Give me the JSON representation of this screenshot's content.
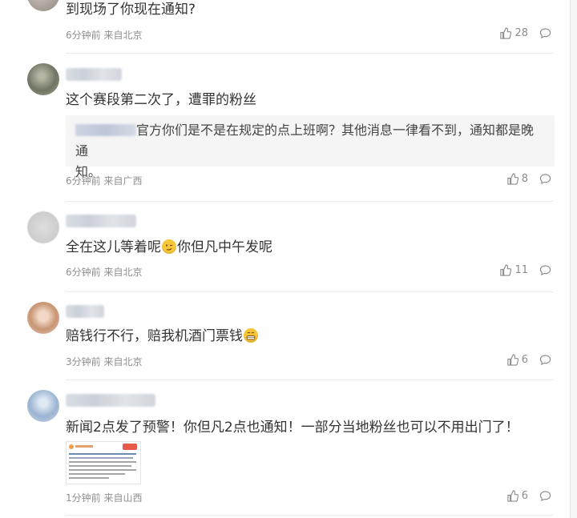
{
  "comments": [
    {
      "text": "到现场了你现在通知?",
      "time": "6分钟前",
      "location": "来自北京",
      "likes": "28"
    },
    {
      "text": "这个赛段第二次了，遭罪的粉丝",
      "quote_text": "官方你们是不是在规定的点上班啊？其他消息一律看不到，通知都是晚通",
      "quote_text_2": "知。",
      "time": "6分钟前",
      "location": "来自广西",
      "likes": "8"
    },
    {
      "text_before": "全在这儿等着呢",
      "text_after": "你但凡中午发呢",
      "emoji": "smirk-emoji",
      "time": "6分钟前",
      "location": "来自北京",
      "likes": "11"
    },
    {
      "text": "赔钱行不行，赔我机酒门票钱",
      "emoji": "grin-emoji",
      "time": "3分钟前",
      "location": "来自北京",
      "likes": "6"
    },
    {
      "text": "新闻2点发了预警！你但凡2点也通知！一部分当地粉丝也可以不用出门了！",
      "time": "1分钟前",
      "location": "来自山西",
      "likes": "6"
    }
  ],
  "icons": {
    "like": "thumb-up-icon",
    "reply": "comment-bubble-icon"
  }
}
